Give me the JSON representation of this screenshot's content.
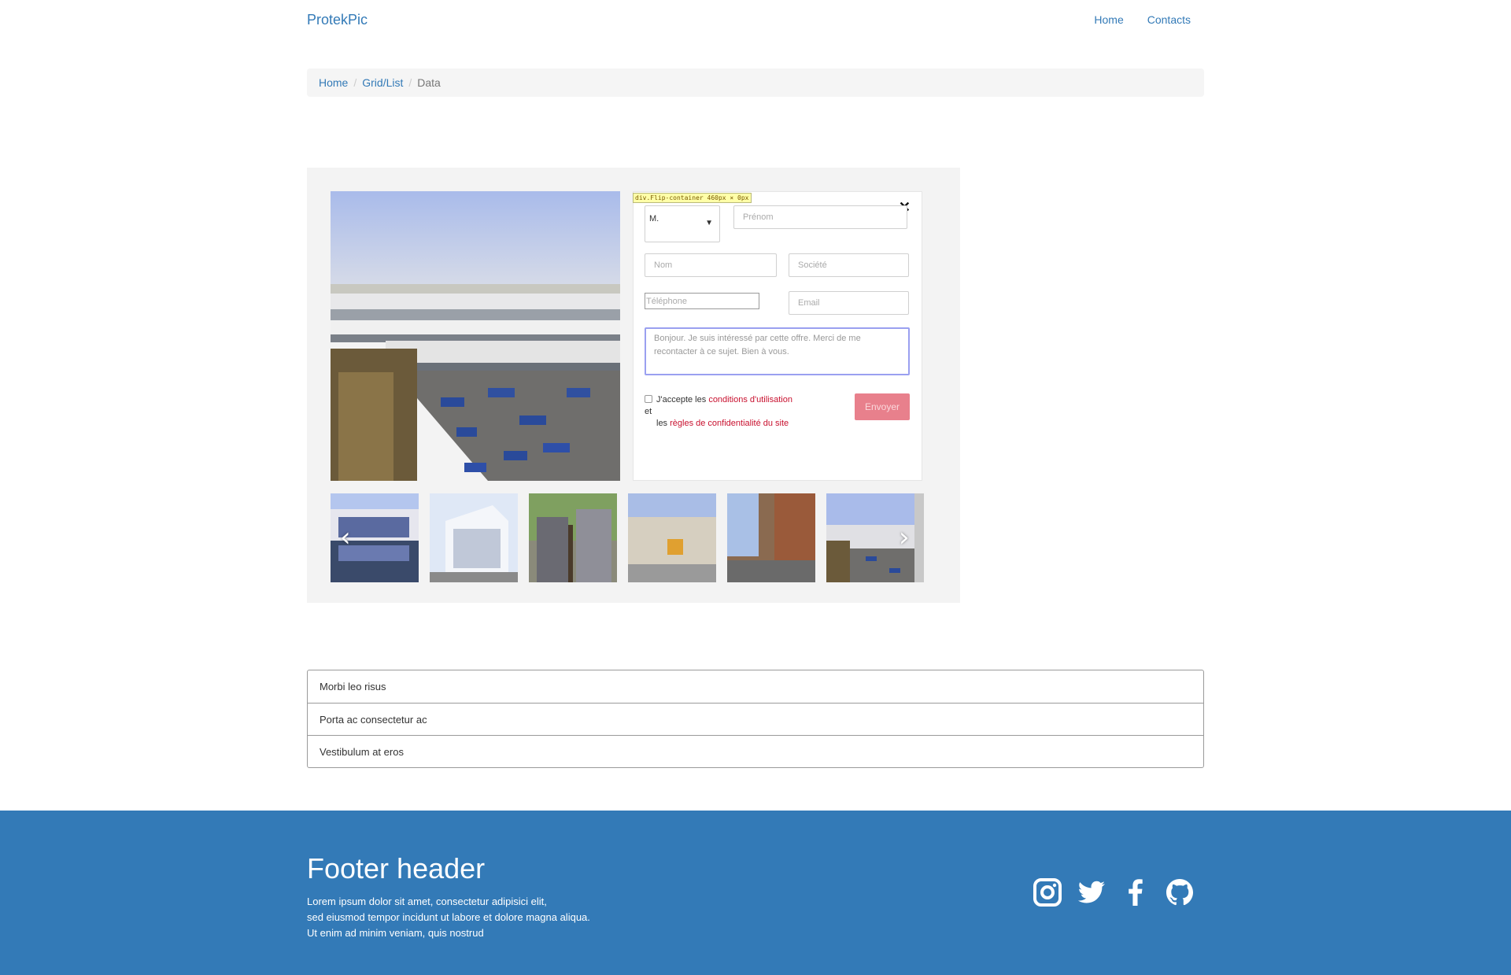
{
  "nav": {
    "brand": "ProtekPic",
    "links": [
      "Home",
      "Contacts"
    ]
  },
  "breadcrumb": {
    "items": [
      "Home",
      "Grid/List"
    ],
    "active": "Data"
  },
  "form": {
    "devtools_tip": "div.Flip-container 460px × 0px",
    "civility": "M.",
    "placeholders": {
      "firstname": "Prénom",
      "lastname": "Nom",
      "company": "Société",
      "phone": "Téléphone",
      "email": "Email"
    },
    "message": "Bonjour. Je suis intéressé par cette offre. Merci de me recontacter à ce sujet. Bien à vous.",
    "consent": {
      "prefix": "J'accepte les ",
      "link1": "conditions d'utilisation",
      "mid": " et",
      "prefix2": "les ",
      "link2": "règles de confidentialité du site"
    },
    "submit": "Envoyer"
  },
  "icons": {
    "close": "close-icon",
    "prev": "chevron-left-icon",
    "next": "chevron-right-icon",
    "dropdown": "chevron-down-icon"
  },
  "list": {
    "items": [
      "Morbi leo risus",
      "Porta ac consectetur ac",
      "Vestibulum at eros"
    ]
  },
  "footer": {
    "title": "Footer header",
    "lines": [
      "Lorem ipsum dolor sit amet, consectetur adipisici elit,",
      "sed eiusmod tempor incidunt ut labore et dolore magna aliqua.",
      "Ut enim ad minim veniam, quis nostrud"
    ],
    "social": [
      "instagram-icon",
      "twitter-icon",
      "facebook-icon",
      "github-icon"
    ]
  },
  "colors": {
    "link": "#337ab7",
    "footer_bg": "#337ab7",
    "accent_red": "#c8102e",
    "button": "#e8808c"
  }
}
